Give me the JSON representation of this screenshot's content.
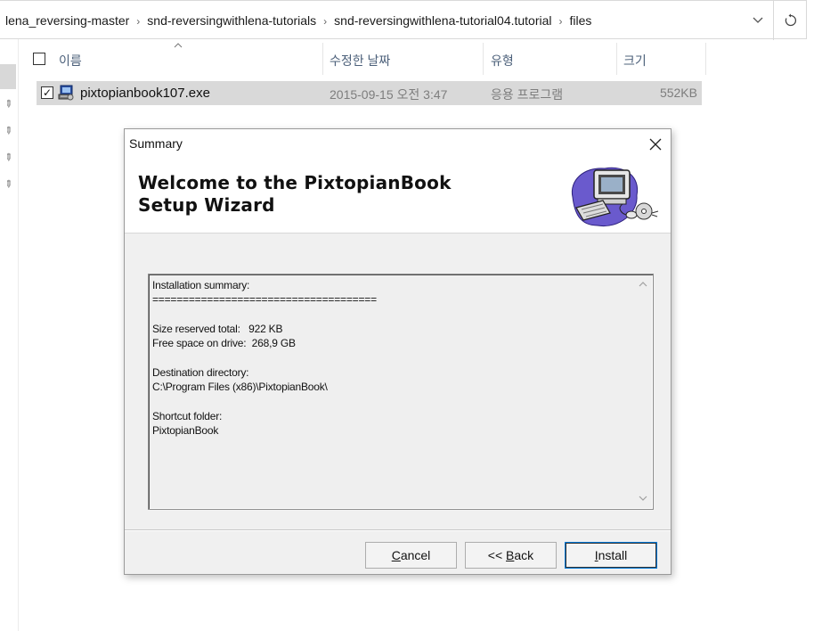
{
  "address_bar": {
    "crumbs": [
      "lena_reversing-master",
      "snd-reversingwithlena-tutorials",
      "snd-reversingwithlena-tutorial04.tutorial",
      "files"
    ],
    "separator": "›",
    "dropdown_icon": "chevron-down-icon",
    "refresh_icon": "refresh-icon"
  },
  "columns": {
    "name": "이름",
    "modified": "수정한 날짜",
    "type": "유형",
    "size": "크기"
  },
  "files": [
    {
      "name": "pixtopianbook107.exe",
      "modified": "2015-09-15 오전 3:47",
      "type": "응용 프로그램",
      "size": "552KB",
      "checked": true,
      "icon": "setup-exe-icon"
    }
  ],
  "dialog": {
    "title": "Summary",
    "heading": "Welcome to the PixtopianBook Setup Wizard",
    "summary_lines": [
      "Installation summary:",
      "=====================================",
      "",
      "Size reserved total:   922 KB",
      "Free space on drive:  268,9 GB",
      "",
      "Destination directory:",
      "C:\\Program Files (x86)\\PixtopianBook\\",
      "",
      "Shortcut folder:",
      "PixtopianBook"
    ],
    "buttons": {
      "cancel": {
        "accel": "C",
        "rest": "ancel"
      },
      "back": {
        "prefix": "<< ",
        "accel": "B",
        "rest": "ack"
      },
      "install": {
        "accel": "I",
        "rest": "nstall"
      }
    }
  },
  "colors": {
    "row_selected": "#d9d9d9",
    "column_header_text": "#4c607a",
    "dialog_bg": "#f0f0f0",
    "default_button_border": "#0078d7"
  }
}
